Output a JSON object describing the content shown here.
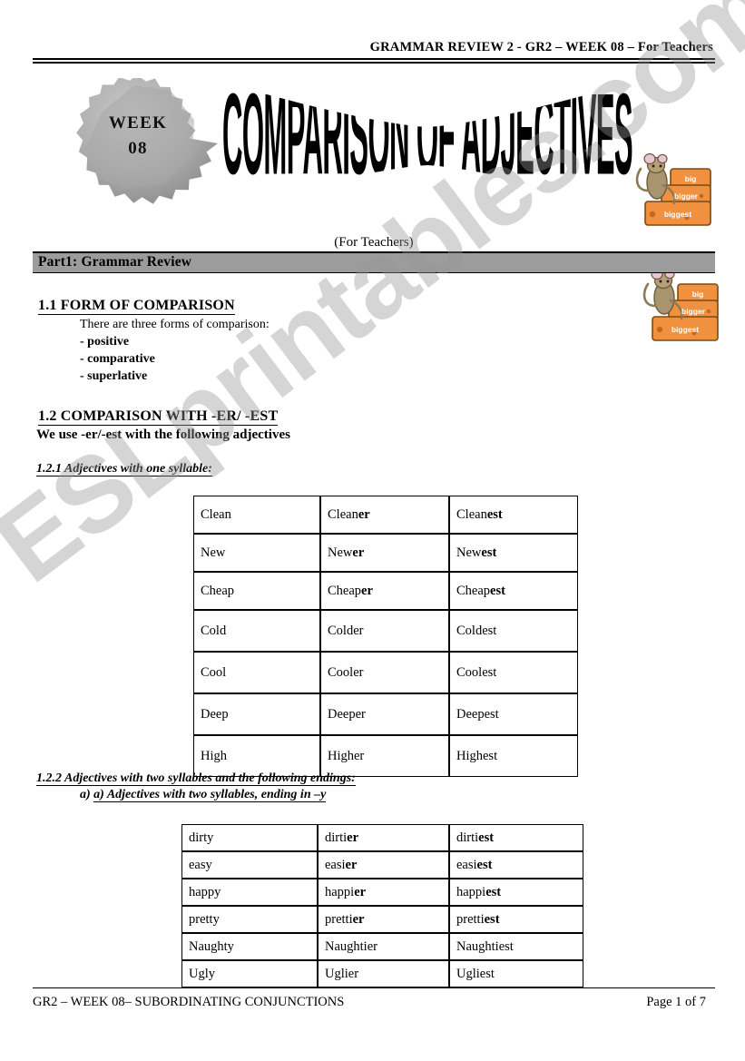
{
  "header": {
    "running_head": "GRAMMAR REVIEW 2 - GR2 – WEEK 08 – For Teachers"
  },
  "banner": {
    "badge_line1": "WEEK",
    "badge_line2": "08",
    "badge_color": "#a8a8a8",
    "title": "COMPARISON OF ADJECTIVES",
    "clipart_labels": {
      "big": "big",
      "bigger": "bigger",
      "biggest": "biggest"
    },
    "clipart_color": "#e8873a",
    "mouse_color": "#9c8a66"
  },
  "subtitle": "(For Teachers)",
  "part_banner": {
    "label": "Part1: Grammar Review",
    "background": "#9c9c9c"
  },
  "sections": {
    "s11": {
      "heading": "1.1 FORM OF COMPARISON",
      "intro": "There are three forms of comparison:",
      "items": [
        "- positive",
        "- comparative",
        "- superlative"
      ]
    },
    "s12": {
      "heading": "1.2 COMPARISON WITH -ER/ -EST",
      "intro": "We use -er/-est with the following adjectives",
      "sub1": "1.2.1 Adjectives with one syllable:",
      "sub2": "1.2.2 Adjectives with two syllables and the following endings:",
      "sub2a": "a) Adjectives with two syllables, ending in –y"
    }
  },
  "table1": {
    "rows": [
      {
        "positive": "Clean",
        "comp_stem": "Clean",
        "comp_suffix": "er",
        "sup_stem": "Clean",
        "sup_suffix": "est"
      },
      {
        "positive": "New",
        "comp_stem": "New",
        "comp_suffix": "er",
        "sup_stem": "New",
        "sup_suffix": "est"
      },
      {
        "positive": "Cheap",
        "comp_stem": "Cheap",
        "comp_suffix": "er",
        "sup_stem": "Cheap",
        "sup_suffix": "est"
      },
      {
        "positive": "Cold",
        "comp_stem": "Colder",
        "comp_suffix": "",
        "sup_stem": "Coldest",
        "sup_suffix": ""
      },
      {
        "positive": "Cool",
        "comp_stem": "Cooler",
        "comp_suffix": "",
        "sup_stem": "Coolest",
        "sup_suffix": ""
      },
      {
        "positive": "Deep",
        "comp_stem": "Deeper",
        "comp_suffix": "",
        "sup_stem": "Deepest",
        "sup_suffix": ""
      },
      {
        "positive": "High",
        "comp_stem": "Higher",
        "comp_suffix": "",
        "sup_stem": "Highest",
        "sup_suffix": ""
      }
    ]
  },
  "table2": {
    "rows": [
      {
        "positive": "dirty",
        "comp_stem": "dirti",
        "comp_suffix": "er",
        "sup_stem": "dirti",
        "sup_suffix": "est"
      },
      {
        "positive": "easy",
        "comp_stem": "easi",
        "comp_suffix": "er",
        "sup_stem": "easi",
        "sup_suffix": "est"
      },
      {
        "positive": "happy",
        "comp_stem": "happi",
        "comp_suffix": "er",
        "sup_stem": "happi",
        "sup_suffix": "est"
      },
      {
        "positive": "pretty",
        "comp_stem": "pretti",
        "comp_suffix": "er",
        "sup_stem": "pretti",
        "sup_suffix": "est"
      },
      {
        "positive": "Naughty",
        "comp_stem": "Naughtier",
        "comp_suffix": "",
        "sup_stem": "Naughtiest",
        "sup_suffix": ""
      },
      {
        "positive": "Ugly",
        "comp_stem": "Uglier",
        "comp_suffix": "",
        "sup_stem": "Ugliest",
        "sup_suffix": ""
      }
    ]
  },
  "footer": {
    "left": "GR2 – WEEK 08– SUBORDINATING CONJUNCTIONS",
    "right": "Page 1 of 7"
  },
  "watermark": {
    "text": "ESLprintables.com"
  }
}
